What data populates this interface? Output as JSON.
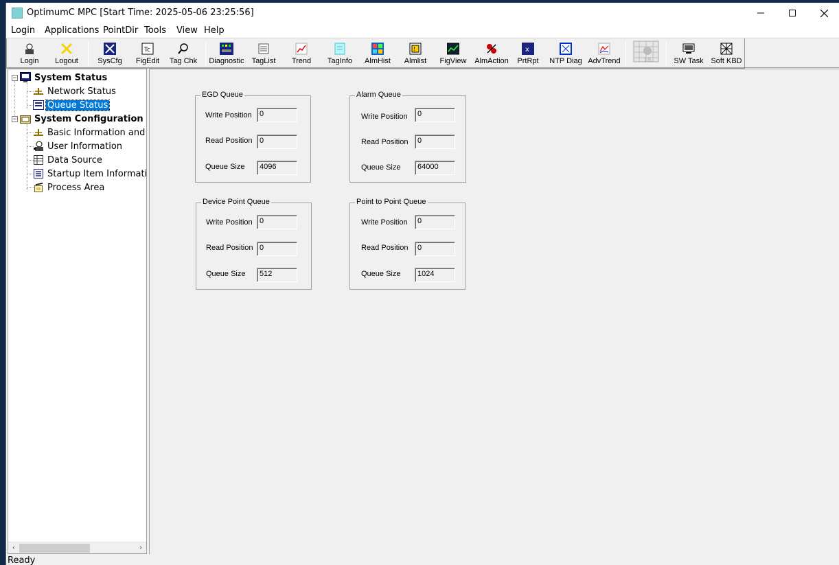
{
  "window": {
    "title": "OptimumC MPC  [Start Time: 2025-05-06 23:25:56]",
    "controls": {
      "minimize": "—",
      "maximize": "☐",
      "close": "✕"
    }
  },
  "menu": [
    "Login",
    "Applications",
    "PointDir",
    "Tools",
    "View",
    "Help"
  ],
  "toolbar": [
    {
      "label": "Login",
      "icon": "login-icon"
    },
    {
      "label": "Logout",
      "icon": "logout-icon"
    },
    {
      "label": "SysCfg",
      "icon": "syscfg-icon"
    },
    {
      "label": "FigEdit",
      "icon": "figedit-icon"
    },
    {
      "label": "Tag Chk",
      "icon": "tag-check-icon"
    },
    {
      "label": "Diagnostic",
      "icon": "diagnostic-icon"
    },
    {
      "label": "TagList",
      "icon": "taglist-icon"
    },
    {
      "label": "Trend",
      "icon": "trend-icon"
    },
    {
      "label": "TagInfo",
      "icon": "taginfo-icon"
    },
    {
      "label": "AlmHist",
      "icon": "alarm-history-icon"
    },
    {
      "label": "Almlist",
      "icon": "alarm-list-icon"
    },
    {
      "label": "FigView",
      "icon": "figview-icon"
    },
    {
      "label": "AlmAction",
      "icon": "alarm-action-icon"
    },
    {
      "label": "PrtRpt",
      "icon": "print-report-icon"
    },
    {
      "label": "NTP Diag",
      "icon": "ntp-diag-icon"
    },
    {
      "label": "AdvTrend",
      "icon": "advanced-trend-icon"
    },
    {
      "label": "",
      "icon": "disabled-grid-icon"
    },
    {
      "label": "SW Task",
      "icon": "sw-task-icon"
    },
    {
      "label": "Soft KBD",
      "icon": "soft-keyboard-icon"
    }
  ],
  "tree": {
    "system_status": "System Status",
    "network_status": "Network Status",
    "queue_status": "Queue Status",
    "system_configuration": "System Configuration",
    "basic_information": "Basic Information and N",
    "user_information": "User Information",
    "data_source": "Data Source",
    "startup_item": "Startup Item Informatior",
    "process_area": "Process Area"
  },
  "queues": {
    "egd": {
      "title": "EGD Queue",
      "write": "0",
      "read": "0",
      "size": "4096"
    },
    "alarm": {
      "title": "Alarm Queue",
      "write": "0",
      "read": "0",
      "size": "64000"
    },
    "device_point": {
      "title": "Device Point Queue",
      "write": "0",
      "read": "0",
      "size": "512"
    },
    "point_to_point": {
      "title": "Point to Point Queue",
      "write": "0",
      "read": "0",
      "size": "1024"
    }
  },
  "labels": {
    "write": "Write Position",
    "read": "Read Position",
    "size": "Queue Size"
  },
  "status": "Ready"
}
